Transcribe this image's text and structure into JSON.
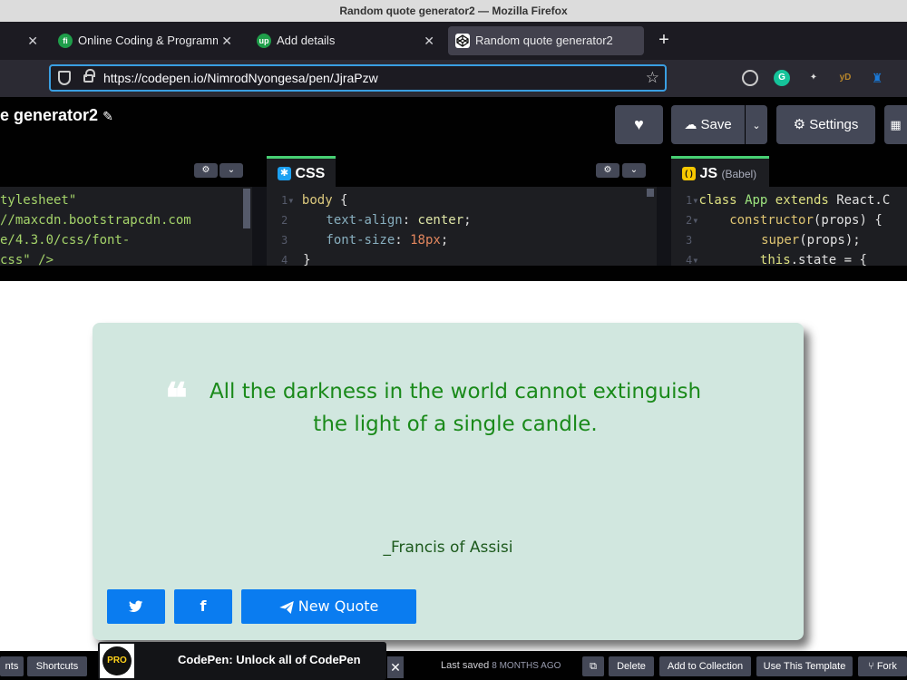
{
  "window": {
    "title": "Random quote generator2 — Mozilla Firefox"
  },
  "tabs": [
    {
      "label": "Online Coding & Programmi",
      "favicon": "fi",
      "favicon_color": "#1f9e4a",
      "active": false
    },
    {
      "label": "Add details",
      "favicon": "up",
      "favicon_color": "#1f9e4a",
      "active": false
    },
    {
      "label": "Random quote generator2",
      "favicon": "codepen-icon",
      "active": true
    }
  ],
  "tab_close_glyph": "✕",
  "new_tab_glyph": "+",
  "urlbar": {
    "url": "https://codepen.io/NimrodNyongesa/pen/JjraPzw"
  },
  "extensions": [
    {
      "name": "stopwatch-icon",
      "glyph": "◔",
      "color": "#2b2a33"
    },
    {
      "name": "grammarly-icon",
      "glyph": "G",
      "color": "#15c39a"
    },
    {
      "name": "puzzle-icon",
      "glyph": "✦",
      "color": "#2b2a33"
    },
    {
      "name": "yd-icon",
      "glyph": "yD",
      "color": "#2b2a33"
    },
    {
      "name": "trophy-icon",
      "glyph": "♜",
      "color": "#2b2a33"
    }
  ],
  "codepen": {
    "pen_title": "e generator2",
    "edit_glyph": "✎",
    "save_label": "Save",
    "settings_label": "Settings",
    "accent": "#47cf73"
  },
  "editors": {
    "css_label": "CSS",
    "js_label": "JS",
    "js_sub": "(Babel)",
    "html_lines": [
      {
        "text": "tylesheet\""
      },
      {
        "text": "//maxcdn.bootstrapcdn.com"
      },
      {
        "text": "e/4.3.0/css/font-"
      },
      {
        "text": "css\" />"
      }
    ],
    "css_lines": [
      {
        "num": "1",
        "fold": "▾",
        "sel": "body",
        "rest": " {"
      },
      {
        "num": "2",
        "prop": "text-align",
        "val": "center",
        "end": ";"
      },
      {
        "num": "3",
        "prop": "font-size",
        "val": "18px",
        "end": ";"
      },
      {
        "num": "4",
        "fold": "",
        "rest": "}"
      }
    ],
    "js_lines": [
      {
        "num": "1",
        "kw": "class",
        "cls": "App",
        "kw2": "extends",
        "rest": "React.C"
      },
      {
        "num": "2",
        "fn": "constructor",
        "rest": "(props) {"
      },
      {
        "num": "3",
        "fn": "super",
        "rest": "(props);"
      },
      {
        "num": "4",
        "kw": "this",
        "rest": ".state = {"
      }
    ]
  },
  "quote": {
    "text": "All the darkness in the world cannot extinguish the light of a single candle.",
    "author": "_Francis of Assisi",
    "new_quote_label": "New Quote",
    "quote_color": "#1a8a1a",
    "card_color": "#d1e7df",
    "button_color": "#0a7cf0"
  },
  "footer": {
    "left_btn": "nts",
    "shortcuts": "Shortcuts",
    "promo": "CodePen: Unlock all of CodePen",
    "pro_badge": "PRO",
    "last_saved_label": "Last saved",
    "last_saved_value": "8 MONTHS AGO",
    "delete": "Delete",
    "add_to_collection": "Add to Collection",
    "use_template": "Use This Template",
    "fork": "Fork"
  }
}
